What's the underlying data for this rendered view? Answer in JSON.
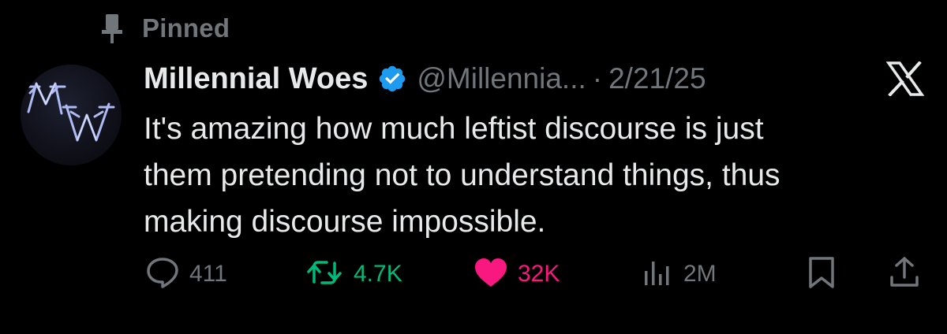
{
  "pinned": {
    "label": "Pinned",
    "icon": "pin-icon"
  },
  "author": {
    "display_name": "Millennial Woes",
    "handle": "@Millennia...",
    "verified": true,
    "avatar_text": "MW",
    "separator": "·",
    "date": "2/21/25"
  },
  "tweet": {
    "text_lines": [
      "It's amazing how much leftist discourse is just",
      "them pretending not to understand things, thus",
      "making discourse impossible."
    ]
  },
  "actions": {
    "reply_count": "411",
    "retweet_count": "4.7K",
    "like_count": "32K",
    "view_count": "2M",
    "icons": [
      "reply-icon",
      "retweet-icon",
      "like-icon",
      "views-icon",
      "bookmark-icon",
      "share-icon"
    ]
  },
  "colors": {
    "background": "#000000",
    "text": "#e7e9ea",
    "muted": "#71767b",
    "verified": "#1d9bf0",
    "retweet": "#00ba7c",
    "like": "#f91880"
  },
  "brand": {
    "logo": "x-logo-icon"
  }
}
